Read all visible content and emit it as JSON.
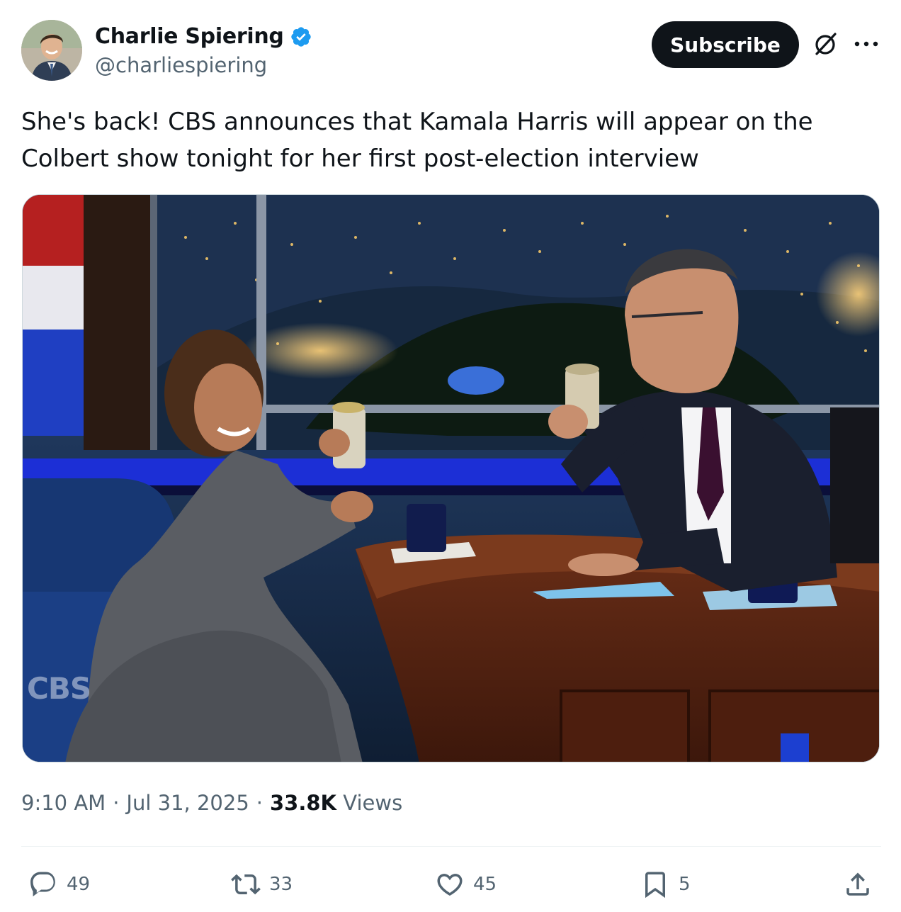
{
  "author": {
    "display_name": "Charlie Spiering",
    "handle": "@charliespiering",
    "verified": true
  },
  "header": {
    "subscribe_label": "Subscribe"
  },
  "tweet": {
    "text": "She's back! CBS announces that Kamala Harris will appear on the Colbert show tonight for her first post-election interview"
  },
  "media": {
    "watermark": "CBS"
  },
  "meta": {
    "time": "9:10 AM",
    "separator": "·",
    "date": "Jul 31, 2025",
    "views_count": "33.8K",
    "views_label": "Views"
  },
  "actions": {
    "replies": "49",
    "reposts": "33",
    "likes": "45",
    "bookmarks": "5"
  },
  "colors": {
    "verified": "#1d9bf0",
    "button_bg": "#0f1419",
    "secondary_text": "#536471"
  },
  "icons": [
    "verified-badge-icon",
    "grok-icon",
    "more-icon",
    "reply-icon",
    "repost-icon",
    "like-icon",
    "bookmark-icon",
    "share-icon"
  ]
}
